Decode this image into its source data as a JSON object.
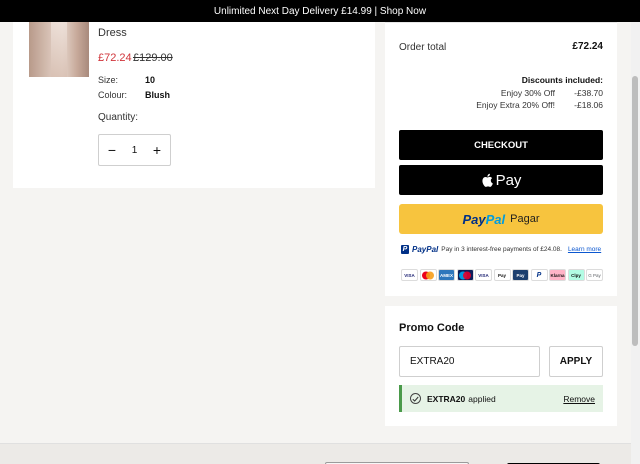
{
  "topbar": {
    "text": "Unlimited Next Day Delivery £14.99 | Shop Now"
  },
  "product": {
    "name": "Dress",
    "price_now": "£72.24",
    "price_was": "£129.00",
    "attributes": [
      {
        "label": "Size:",
        "value": "10"
      },
      {
        "label": "Colour:",
        "value": "Blush"
      }
    ],
    "quantity_label": "Quantity:",
    "quantity": "1",
    "minus_symbol": "−",
    "plus_symbol": "+"
  },
  "summary": {
    "order_total_label": "Order total",
    "order_total_value": "£72.24",
    "discounts_heading": "Discounts included:",
    "discounts": [
      {
        "label": "Enjoy 30% Off",
        "amount": "-£38.70"
      },
      {
        "label": "Enjoy Extra 20% Off!",
        "amount": "-£18.06"
      }
    ],
    "checkout_label": "CHECKOUT",
    "applepay_label": "Pay",
    "paypal_pay": "Pay",
    "paypal_pal": "Pal",
    "paypal_pagar": "Pagar",
    "paypal_mark": "P",
    "paypal_brand": "PayPal",
    "paypal_info": "Pay in 3 interest-free payments of £24.08.",
    "paypal_learn_more": "Learn more",
    "payment_cards": [
      "VISA",
      "MC",
      "AMEX",
      "Maestro",
      "VISA",
      "Pay",
      "Pay",
      "P",
      "Klarna",
      "Clpy",
      "G Pay"
    ]
  },
  "promo": {
    "title": "Promo Code",
    "input_value": "EXTRA20",
    "apply_label": "APPLY",
    "applied_code": "EXTRA20",
    "applied_text": "applied",
    "remove_label": "Remove"
  },
  "colors": {
    "sale_red": "#d0343a",
    "paypal_yellow": "#f7c43e",
    "success_green": "#e6f3e6"
  }
}
